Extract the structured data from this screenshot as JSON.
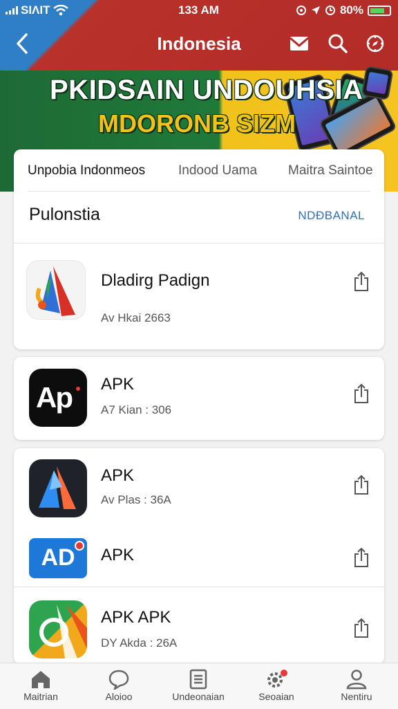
{
  "status_bar": {
    "carrier": "SIΛIT",
    "time": "133 AM",
    "battery_percent": "80%"
  },
  "nav": {
    "title": "Indonesia"
  },
  "banner": {
    "line1": "PKIDSAIN UNDOUHSIA",
    "line2": "MDORONB SIZM"
  },
  "tabs": [
    {
      "label": "Unpobia Indonmeos",
      "active": true
    },
    {
      "label": "Indood Uama",
      "active": false
    },
    {
      "label": "Maitra Saintoe",
      "active": false
    }
  ],
  "section": {
    "title": "Pulonstia",
    "link": "NDÐBANAL"
  },
  "apps": [
    {
      "name": "Dladirg Padign",
      "meta": "Av Hkai 2663"
    },
    {
      "name": "APK",
      "meta": "A7 Kian : 306",
      "icon_text": "Ap"
    },
    {
      "name": "APK",
      "meta": "Av Plas : 36A"
    },
    {
      "name": "APK",
      "meta": "",
      "icon_text": "AD"
    },
    {
      "name": "APK APK",
      "meta": "DY Akda : 26A"
    }
  ],
  "bottom_nav": [
    {
      "label": "Maitrian",
      "icon": "home-icon"
    },
    {
      "label": "Aloioo",
      "icon": "chat-icon"
    },
    {
      "label": "Undeonaian",
      "icon": "list-icon"
    },
    {
      "label": "Seoaian",
      "icon": "gear-icon"
    },
    {
      "label": "Nentiru",
      "icon": "person-icon"
    }
  ],
  "colors": {
    "red": "#b02a28",
    "blue": "#2f7fc6",
    "green": "#1f7a3a",
    "yellow": "#f2c21b",
    "link": "#2f6fb0"
  }
}
